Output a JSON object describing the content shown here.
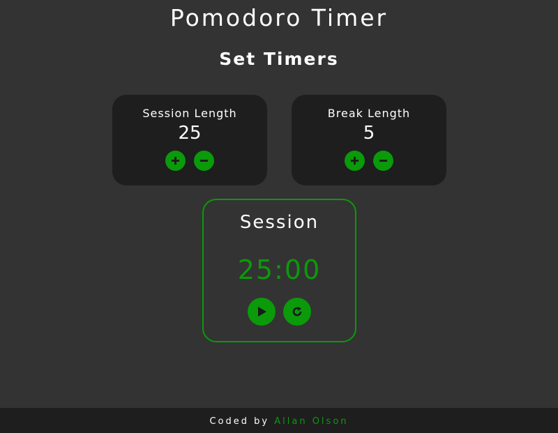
{
  "header": {
    "title": "Pomodoro Timer",
    "subtitle": "Set Timers"
  },
  "session_length": {
    "label": "Session Length",
    "value": "25",
    "increment_icon": "plus-icon",
    "decrement_icon": "minus-icon"
  },
  "break_length": {
    "label": "Break Length",
    "value": "5",
    "increment_icon": "plus-icon",
    "decrement_icon": "minus-icon"
  },
  "timer": {
    "label": "Session",
    "time": "25:00",
    "play_icon": "play-icon",
    "reset_icon": "refresh-icon"
  },
  "footer": {
    "prefix": "Coded by",
    "author": "Allan Olson"
  },
  "colors": {
    "background": "#333333",
    "card": "#1e1e1e",
    "accent": "#0a9a0a",
    "text": "#ffffff"
  }
}
